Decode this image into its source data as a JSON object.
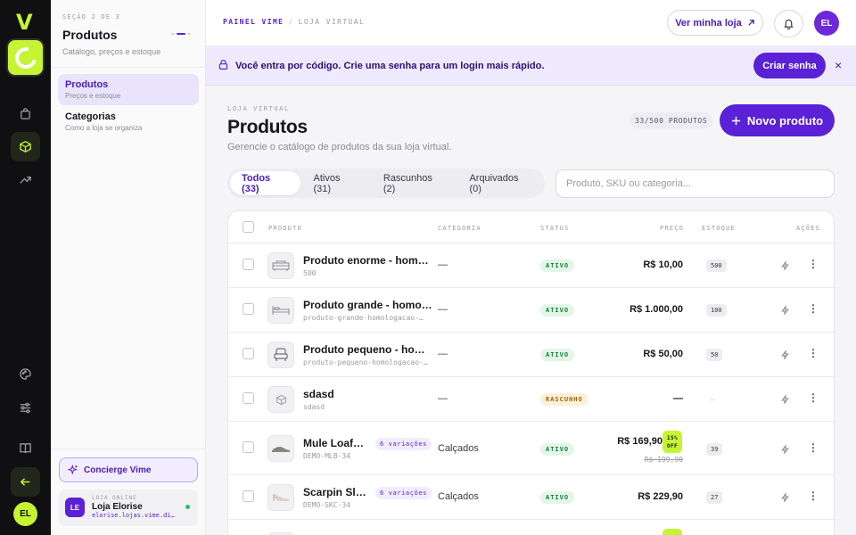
{
  "rail": {
    "logo": "V",
    "avatar": "EL"
  },
  "sidebar": {
    "section_label": "SEÇÃO 2 DE 3",
    "title": "Produtos",
    "subtitle": "Catálogo, preços e estoque",
    "items": [
      {
        "label": "Produtos",
        "sub": "Preços e estoque",
        "active": true
      },
      {
        "label": "Categorias",
        "sub": "Como a loja se organiza",
        "active": false
      }
    ],
    "concierge_label": "Concierge Vime",
    "store": {
      "badge": "LE",
      "kicker": "LOJA ONLINE",
      "name": "Loja Elorise",
      "url": "elorise.lojas.vime.di…"
    }
  },
  "topbar": {
    "crumb_root": "PAINEL VIME",
    "crumb_sep": "/",
    "crumb_current": "LOJA VIRTUAL",
    "view_store_label": "Ver minha loja",
    "avatar": "EL"
  },
  "banner": {
    "text_before": "Você entra por ",
    "text_bold": "código",
    "text_after": ". Crie uma senha para um login mais rápido.",
    "cta_label": "Criar senha",
    "close_glyph": "×"
  },
  "page": {
    "eyebrow": "LOJA VIRTUAL",
    "title": "Produtos",
    "description": "Gerencie o catálogo de produtos da sua loja virtual.",
    "count_label": "33/500 PRODUTOS",
    "new_button_label": "Novo produto"
  },
  "tabs": [
    {
      "label": "Todos (33)",
      "active": true
    },
    {
      "label": "Ativos (31)",
      "active": false
    },
    {
      "label": "Rascunhos (2)",
      "active": false
    },
    {
      "label": "Arquivados (0)",
      "active": false
    }
  ],
  "search": {
    "placeholder": "Produto, SKU ou categoria..."
  },
  "table": {
    "headers": {
      "product": "PRODUTO",
      "category": "CATEGORIA",
      "status": "STATUS",
      "price": "PREÇO",
      "stock": "ESTOQUE",
      "actions": "AÇÕES"
    },
    "rows": [
      {
        "name": "Produto enorme - homol…",
        "sku": "500",
        "category": "—",
        "status": "ATIVO",
        "price": "R$ 10,00",
        "stock": "500"
      },
      {
        "name": "Produto grande - homol…",
        "sku": "produto-grande-homologacao-…",
        "category": "—",
        "status": "ATIVO",
        "price": "R$ 1.000,00",
        "stock": "100"
      },
      {
        "name": "Produto pequeno - homo…",
        "sku": "produto-pequeno-homologacao-…",
        "category": "—",
        "status": "ATIVO",
        "price": "R$ 50,00",
        "stock": "50"
      },
      {
        "name": "sdasd",
        "sku": "sdasd",
        "category": "—",
        "status": "RASCUNHO",
        "price": "—",
        "stock": "—"
      },
      {
        "name": "Mule Loafer …",
        "sku": "DEMO-MLB-34",
        "variations": "6 variações",
        "category": "Calçados",
        "status": "ATIVO",
        "price": "R$ 169,90",
        "old_price": "R$ 199,90",
        "discount": "15% OFF",
        "stock": "39"
      },
      {
        "name": "Scarpin Slin…",
        "sku": "DEMO-SKC-34",
        "variations": "6 variações",
        "category": "Calçados",
        "status": "ATIVO",
        "price": "R$ 229,90",
        "stock": "27"
      }
    ]
  }
}
